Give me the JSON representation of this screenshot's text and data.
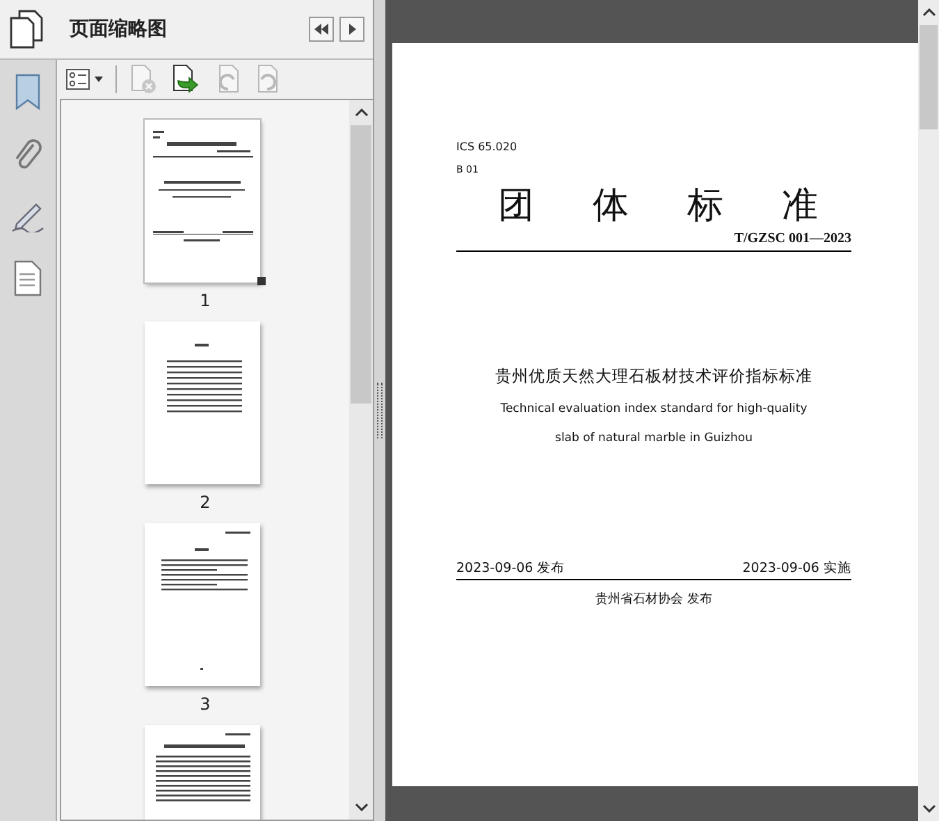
{
  "panel": {
    "title": "页面缩略图"
  },
  "rail": [
    {
      "kind": "bookmark",
      "selected": false
    },
    {
      "kind": "paperclip",
      "selected": false
    },
    {
      "kind": "pen",
      "selected": false
    },
    {
      "kind": "page",
      "selected": false
    }
  ],
  "toolbar": [
    {
      "kind": "options",
      "disabled": false
    },
    {
      "kind": "delete",
      "disabled": true
    },
    {
      "kind": "insert",
      "disabled": false
    },
    {
      "kind": "rotate-left",
      "disabled": true
    },
    {
      "kind": "rotate-right",
      "disabled": true
    }
  ],
  "thumbnails": [
    {
      "page": "1",
      "kind": "cover",
      "selected": true
    },
    {
      "page": "2",
      "kind": "contents",
      "selected": false
    },
    {
      "page": "3",
      "kind": "foreword",
      "selected": false
    },
    {
      "kind": "body",
      "selected": false
    }
  ],
  "document": {
    "ics": "ICS 65.020",
    "ccs": "B 01",
    "heading_chars": [
      "团",
      "体",
      "标",
      "准"
    ],
    "number": "T/GZSC 001—2023",
    "title_zh": "贵州优质天然大理石板材技术评价指标标准",
    "title_en_lines": [
      "Technical evaluation index standard for high-quality",
      "slab of natural marble in Guizhou"
    ],
    "issue_date": "2023-09-06 发布",
    "effective_date": "2023-09-06 实施",
    "publisher": "贵州省石材协会  发布"
  }
}
